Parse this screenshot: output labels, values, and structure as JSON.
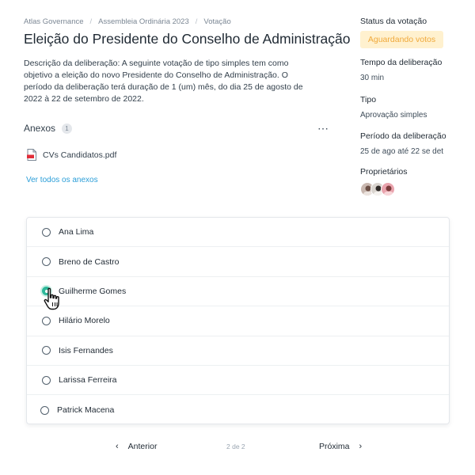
{
  "breadcrumb": {
    "items": [
      "Atlas Governance",
      "Assembleia Ordinária 2023",
      "Votação"
    ],
    "separator": "/"
  },
  "page_title": "Eleição do Presidente do Conselho de Administração",
  "description": "Descrição da deliberação: A seguinte votação de tipo simples tem como objetivo a eleição do novo Presidente do Conselho de Administração. O período da deliberação terá duração de 1 (um) mês, do dia 25 de agosto de 2022 à 22 de setembro de 2022.",
  "attachments": {
    "title": "Anexos",
    "count": "1",
    "more_icon": "⋯",
    "files": [
      {
        "name": "CVs Candidatos.pdf",
        "icon": "pdf-file-icon"
      }
    ],
    "see_all_label": "Ver todos os anexos"
  },
  "sidebar": {
    "status_label": "Status da votação",
    "status_value": "Aguardando votos",
    "duration_label": "Tempo da deliberação",
    "duration_value": "30 min",
    "type_label": "Tipo",
    "type_value": "Aprovação simples",
    "period_label": "Período da deliberação",
    "period_value": "25 de ago até 22 se det",
    "owners_label": "Proprietários",
    "owners_count": 3
  },
  "candidates": [
    {
      "name": "Ana Lima",
      "selected": false
    },
    {
      "name": "Breno de Castro",
      "selected": false
    },
    {
      "name": "Guilherme Gomes",
      "selected": true
    },
    {
      "name": "Hilário Morelo",
      "selected": false
    },
    {
      "name": "Isis Fernandes",
      "selected": false
    },
    {
      "name": "Larissa Ferreira",
      "selected": false
    },
    {
      "name": "Patrick Macena",
      "selected": false
    }
  ],
  "pager": {
    "prev_label": "Anterior",
    "next_label": "Próxima",
    "page_indicator": "2 de 2"
  },
  "colors": {
    "accent_teal": "#2eb89a",
    "link_blue": "#2b9ed8",
    "status_bg": "#fff1cf",
    "status_text": "#f0a93b"
  }
}
